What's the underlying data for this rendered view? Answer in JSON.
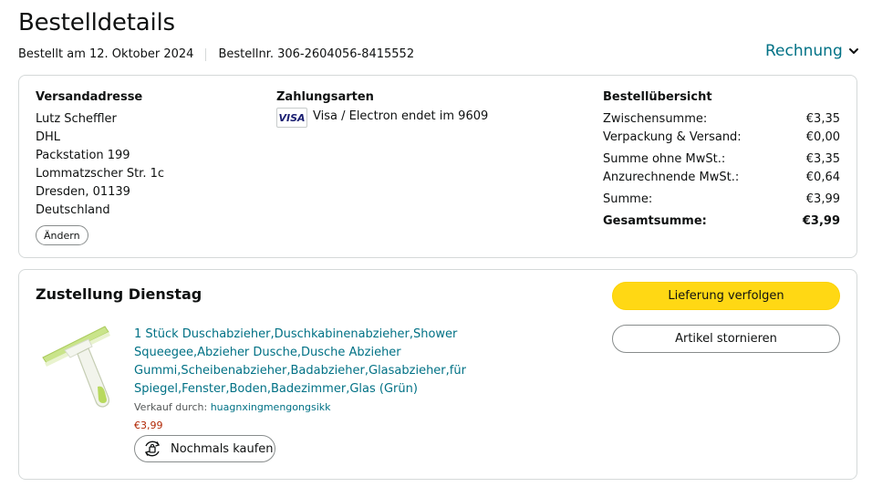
{
  "header": {
    "title": "Bestelldetails",
    "ordered_on": "Bestellt am 12. Oktober 2024",
    "order_number": "Bestellnr. 306-2604056-8415552",
    "invoice_label": "Rechnung"
  },
  "shipping": {
    "title": "Versandadresse",
    "lines": [
      "Lutz Scheffler",
      "DHL",
      "Packstation 199",
      "Lommatzscher Str. 1c",
      "Dresden, 01139",
      "Deutschland"
    ],
    "change_label": "Ändern"
  },
  "payment": {
    "title": "Zahlungsarten",
    "card_brand": "VISA",
    "card_text": "Visa / Electron  endet im 9609"
  },
  "summary": {
    "title": "Bestellübersicht",
    "rows": [
      {
        "label": "Zwischensumme:",
        "value": "€3,35"
      },
      {
        "label": "Verpackung & Versand:",
        "value": "€0,00"
      },
      {
        "label": "Summe ohne MwSt.:",
        "value": "€3,35"
      },
      {
        "label": "Anzurechnende MwSt.:",
        "value": "€0,64"
      },
      {
        "label": "Summe:",
        "value": "€3,99"
      },
      {
        "label": "Gesamtsumme:",
        "value": "€3,99"
      }
    ]
  },
  "delivery": {
    "title": "Zustellung Dienstag",
    "product_title": "1 Stück Duschabzieher,Duschkabinenabzieher,Shower Squeegee,Abzieher Dusche,Dusche Abzieher Gummi,Scheibenabzieher,Badabzieher,Glasabzieher,für Spiegel,Fenster,Boden,Badezimmer,Glas (Grün)",
    "seller_prefix": "Verkauf durch: ",
    "seller_name": "huagnxingmengongsikk",
    "price": "€3,99",
    "rebuy_label": "Nochmals kaufen",
    "track_label": "Lieferung verfolgen",
    "cancel_label": "Artikel stornieren"
  },
  "colors": {
    "link": "#007185",
    "price": "#b12704",
    "primary_button": "#ffd814",
    "border": "#d5d9d9"
  },
  "icons": {
    "invoice_chevron": "chevron-down-icon",
    "rebuy": "rebuy-cycle-icon",
    "card": "visa-card-icon"
  }
}
